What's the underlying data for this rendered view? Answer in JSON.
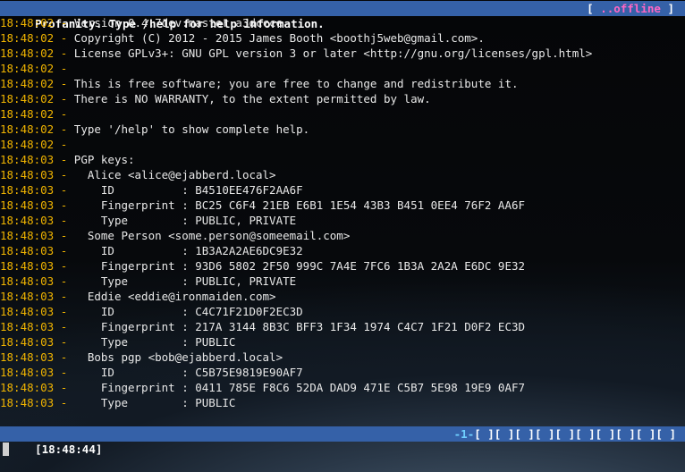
{
  "title_bar": {
    "text": "Profanity. Type /help for help information.",
    "status_open": "[ ",
    "status": "..offline",
    "status_close": " ]"
  },
  "log": [
    {
      "time": "18:48:02",
      "text": "Version 0.4.7dev.master.a3dccce"
    },
    {
      "time": "18:48:02",
      "text": "Copyright (C) 2012 - 2015 James Booth <boothj5web@gmail.com>."
    },
    {
      "time": "18:48:02",
      "text": "License GPLv3+: GNU GPL version 3 or later <http://gnu.org/licenses/gpl.html>"
    },
    {
      "time": "18:48:02",
      "text": ""
    },
    {
      "time": "18:48:02",
      "text": "This is free software; you are free to change and redistribute it."
    },
    {
      "time": "18:48:02",
      "text": "There is NO WARRANTY, to the extent permitted by law."
    },
    {
      "time": "18:48:02",
      "text": ""
    },
    {
      "time": "18:48:02",
      "text": "Type '/help' to show complete help."
    },
    {
      "time": "18:48:02",
      "text": ""
    },
    {
      "time": "18:48:03",
      "text": "PGP keys:"
    },
    {
      "time": "18:48:03",
      "text": "  Alice <alice@ejabberd.local>"
    },
    {
      "time": "18:48:03",
      "text": "    ID          : B4510EE476F2AA6F"
    },
    {
      "time": "18:48:03",
      "text": "    Fingerprint : BC25 C6F4 21EB E6B1 1E54 43B3 B451 0EE4 76F2 AA6F"
    },
    {
      "time": "18:48:03",
      "text": "    Type        : PUBLIC, PRIVATE"
    },
    {
      "time": "18:48:03",
      "text": "  Some Person <some.person@someemail.com>"
    },
    {
      "time": "18:48:03",
      "text": "    ID          : 1B3A2A2AE6DC9E32"
    },
    {
      "time": "18:48:03",
      "text": "    Fingerprint : 93D6 5802 2F50 999C 7A4E 7FC6 1B3A 2A2A E6DC 9E32"
    },
    {
      "time": "18:48:03",
      "text": "    Type        : PUBLIC, PRIVATE"
    },
    {
      "time": "18:48:03",
      "text": "  Eddie <eddie@ironmaiden.com>"
    },
    {
      "time": "18:48:03",
      "text": "    ID          : C4C71F21D0F2EC3D"
    },
    {
      "time": "18:48:03",
      "text": "    Fingerprint : 217A 3144 8B3C BFF3 1F34 1974 C4C7 1F21 D0F2 EC3D"
    },
    {
      "time": "18:48:03",
      "text": "    Type        : PUBLIC"
    },
    {
      "time": "18:48:03",
      "text": "  Bobs pgp <bob@ejabberd.local>"
    },
    {
      "time": "18:48:03",
      "text": "    ID          : C5B75E9819E90AF7"
    },
    {
      "time": "18:48:03",
      "text": "    Fingerprint : 0411 785E F8C6 52DA DAD9 471E C5B7 5E98 19E9 0AF7"
    },
    {
      "time": "18:48:03",
      "text": "    Type        : PUBLIC"
    }
  ],
  "log_separator": " - ",
  "status_bar": {
    "time": "[18:48:44]",
    "active_window": "-1-",
    "windows": "[ ][ ][ ][ ][ ][ ][ ][ ][ ][ ]"
  },
  "colors": {
    "bar_background": "#3561a8",
    "timestamp": "#f0b400",
    "offline": "#ff66c4",
    "active_window": "#6fd0ff"
  }
}
